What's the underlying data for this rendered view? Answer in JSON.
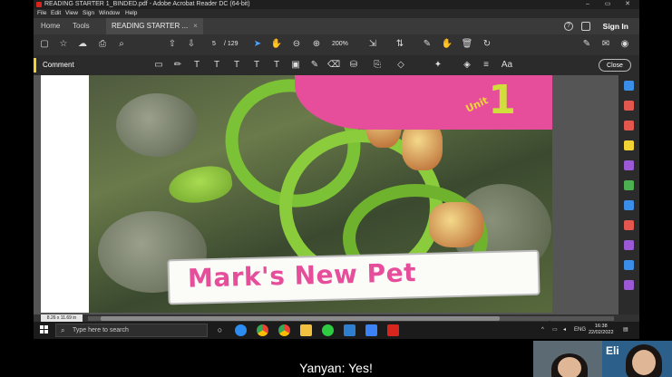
{
  "window": {
    "title": "READING STARTER 1_BINDED.pdf - Adobe Acrobat Reader DC (64-bit)",
    "controls": [
      "–",
      "▭",
      "✕"
    ]
  },
  "menu": [
    "File",
    "Edit",
    "View",
    "Sign",
    "Window",
    "Help"
  ],
  "tabs": {
    "home": "Home",
    "tools": "Tools",
    "document": "READING STARTER ...",
    "document_close": "×",
    "sign_in": "Sign In"
  },
  "toolbar": {
    "current_page": "5",
    "page_separator": "/",
    "total_pages": "129",
    "zoom": "200%"
  },
  "comment_bar": {
    "label": "Comment",
    "close": "Close"
  },
  "page": {
    "unit_word": "Unit",
    "unit_number": "1",
    "banner_title": "Mark's New Pet"
  },
  "status": {
    "page_size": "8.26 x 11.69 in"
  },
  "taskbar": {
    "search_placeholder": "Type here to search",
    "language": "ENG",
    "time": "16:38",
    "date": "22/02/2022"
  },
  "webcam": {
    "right_label": "Eli"
  },
  "caption": "Yanyan: Yes!",
  "colors": {
    "accent_yellow": "#f3d234",
    "acrobat_red": "#d7261e",
    "title_pink": "#e64e9b",
    "unit_green": "#cfe03a",
    "snake_green": "#7cc236"
  }
}
